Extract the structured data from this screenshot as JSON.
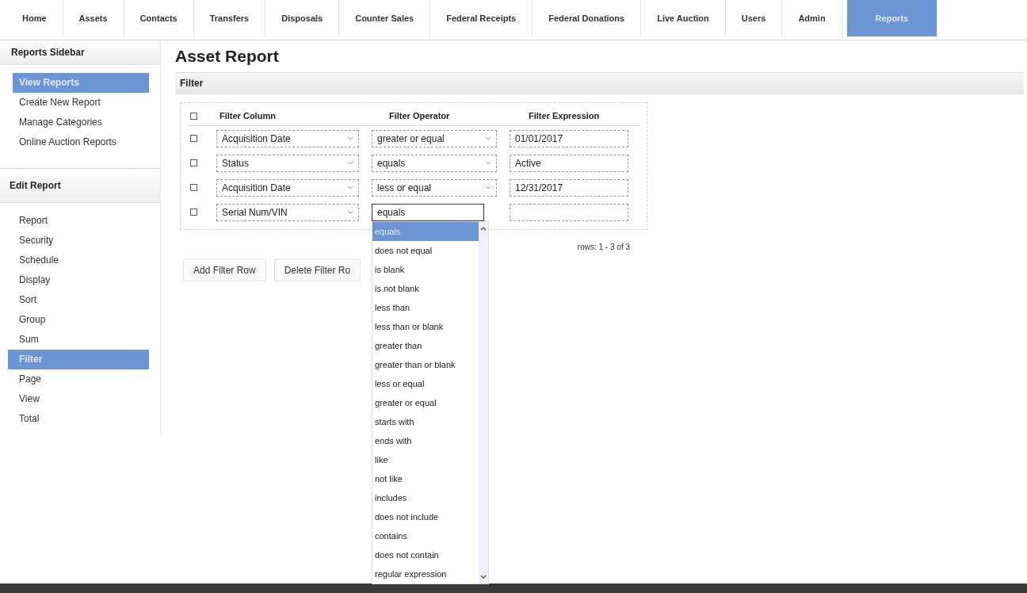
{
  "tabs": [
    {
      "label": "Home",
      "selected": false
    },
    {
      "label": "Assets",
      "selected": false
    },
    {
      "label": "Contacts",
      "selected": false
    },
    {
      "label": "Transfers",
      "selected": false
    },
    {
      "label": "Disposals",
      "selected": false
    },
    {
      "label": "Counter Sales",
      "selected": false
    },
    {
      "label": "Federal Receipts",
      "selected": false
    },
    {
      "label": "Federal Donations",
      "selected": false
    },
    {
      "label": "Live Auction",
      "selected": false
    },
    {
      "label": "Users",
      "selected": false
    },
    {
      "label": "Admin",
      "selected": false
    },
    {
      "label": "Reports",
      "selected": true
    }
  ],
  "sidebar": {
    "title": "Reports Sidebar",
    "items": [
      {
        "label": "View Reports",
        "selected": true
      },
      {
        "label": "Create New Report",
        "selected": false
      },
      {
        "label": "Manage Categories",
        "selected": false
      },
      {
        "label": "Online Auction Reports",
        "selected": false
      }
    ],
    "edit_title": "Edit Report",
    "edit_items": [
      {
        "label": "Report",
        "selected": false
      },
      {
        "label": "Security",
        "selected": false
      },
      {
        "label": "Schedule",
        "selected": false
      },
      {
        "label": "Display",
        "selected": false
      },
      {
        "label": "Sort",
        "selected": false
      },
      {
        "label": "Group",
        "selected": false
      },
      {
        "label": "Sum",
        "selected": false
      },
      {
        "label": "Filter",
        "selected": true
      },
      {
        "label": "Page",
        "selected": false
      },
      {
        "label": "View",
        "selected": false
      },
      {
        "label": "Total",
        "selected": false
      }
    ]
  },
  "page_title": "Asset Report",
  "section_title": "Filter",
  "table": {
    "select_all_checked": false,
    "columns": [
      "Filter Column",
      "Filter Operator",
      "Filter Expression"
    ],
    "rows": [
      {
        "checked": false,
        "column": "Acquisition Date",
        "operator": "greater or equal",
        "expression": "01/01/2017",
        "open": false
      },
      {
        "checked": false,
        "column": "Status",
        "operator": "equals",
        "expression": "Active",
        "open": false
      },
      {
        "checked": false,
        "column": "Acquisition Date",
        "operator": "less or equal",
        "expression": "12/31/2017",
        "open": false
      },
      {
        "checked": false,
        "column": "Serial Num/VIN",
        "operator": "equals",
        "open": true
      }
    ]
  },
  "operator_options": [
    {
      "label": "equals",
      "selected": true
    },
    {
      "label": "does not equal",
      "selected": false
    },
    {
      "label": "is blank",
      "selected": false
    },
    {
      "label": "is not blank",
      "selected": false
    },
    {
      "label": "less than",
      "selected": false
    },
    {
      "label": "less than or blank",
      "selected": false
    },
    {
      "label": "greater than",
      "selected": false
    },
    {
      "label": "greater than or blank",
      "selected": false
    },
    {
      "label": "less or equal",
      "selected": false
    },
    {
      "label": "greater or equal",
      "selected": false
    },
    {
      "label": "starts with",
      "selected": false
    },
    {
      "label": "ends with",
      "selected": false
    },
    {
      "label": "like",
      "selected": false
    },
    {
      "label": "not like",
      "selected": false
    },
    {
      "label": "includes",
      "selected": false
    },
    {
      "label": "does not include",
      "selected": false
    },
    {
      "label": "contains",
      "selected": false
    },
    {
      "label": "does not contain",
      "selected": false
    },
    {
      "label": "regular expression",
      "selected": false
    }
  ],
  "pager": "rows: 1 - 3 of 3",
  "buttons": [
    "Add Filter Row",
    "Delete Filter Ro"
  ]
}
